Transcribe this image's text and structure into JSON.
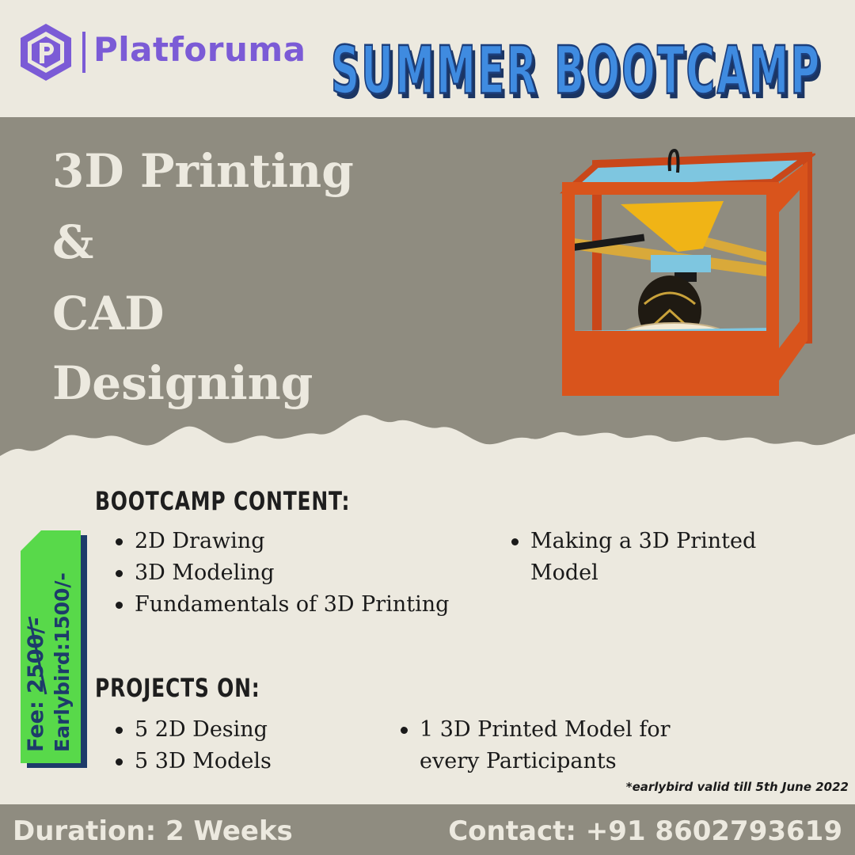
{
  "brand": {
    "name": "Platforuma",
    "logo": "platforuma-hex-logo"
  },
  "headline": "SUMMER BOOTCAMP",
  "course": {
    "lines": [
      "3D Printing",
      "&",
      "CAD",
      "Designing"
    ]
  },
  "illustration": "3d-printer-illustration",
  "fee": {
    "label": "Fee: ",
    "original": "2500/-",
    "earlybird": "Earlybird:1500/-"
  },
  "content": {
    "title": "BOOTCAMP CONTENT:",
    "items": [
      "2D Drawing",
      "3D Modeling",
      "Fundamentals of 3D Printing",
      "Making a 3D Printed",
      "Model"
    ]
  },
  "projects": {
    "title": "PROJECTS ON:",
    "items": [
      "5 2D Desing",
      "5 3D Models",
      "1 3D Printed Model for",
      "every Participants"
    ]
  },
  "note": "*earlybird valid till 5th June 2022",
  "footer": {
    "duration": "Duration: 2 Weeks",
    "contact": "Contact: +91 8602793619"
  },
  "colors": {
    "background": "#ece9df",
    "hero_band": "#8f8c80",
    "brand_purple": "#7b5bd6",
    "headline_blue": "#3f8be0",
    "fee_green": "#58d94a",
    "fee_navy": "#1d3b6a",
    "printer_orange": "#d9541c"
  }
}
